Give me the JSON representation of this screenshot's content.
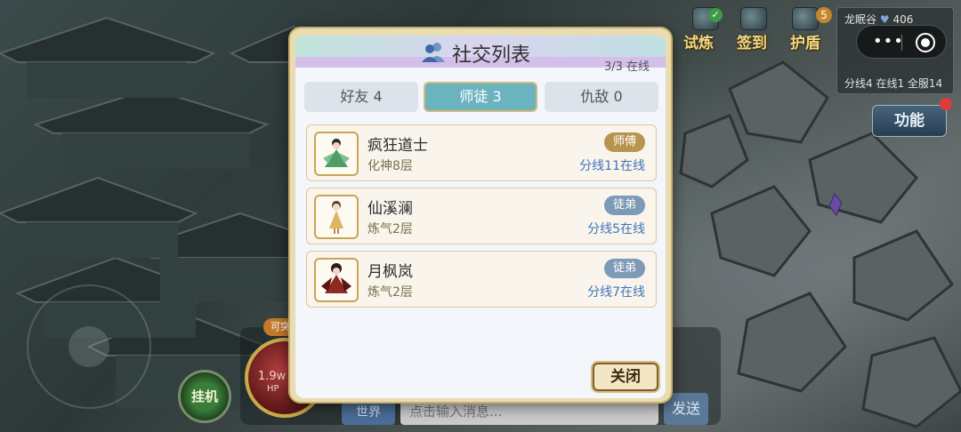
{
  "hud": {
    "trial_label": "试炼",
    "signin_label": "签到",
    "shield_label": "护盾",
    "shield_badge": "5",
    "function_label": "功能",
    "hangup_label": "挂机",
    "hp_value": "1.9w",
    "hp_label": "HP",
    "orb_tag": "可突",
    "send_label": "发送",
    "chat_channel": "世界",
    "chat_placeholder": "点击输入消息..."
  },
  "minimap": {
    "location": "龙眠谷",
    "coord": "406",
    "status": "分线4 在线1 全服14"
  },
  "dialog": {
    "title": "社交列表",
    "online_count": "3/3 在线",
    "tabs": [
      {
        "label": "好友 4",
        "active": false
      },
      {
        "label": "师徒 3",
        "active": true
      },
      {
        "label": "仇敌 0",
        "active": false
      }
    ],
    "entries": [
      {
        "name": "疯狂道士",
        "level": "化神8层",
        "role": "师傅",
        "role_color": "#b8954f",
        "line_status": "分线11在线"
      },
      {
        "name": "仙溪澜",
        "level": "炼气2层",
        "role": "徒弟",
        "role_color": "#7d9ab6",
        "line_status": "分线5在线"
      },
      {
        "name": "月枫岚",
        "level": "炼气2层",
        "role": "徒弟",
        "role_color": "#7d9ab6",
        "line_status": "分线7在线"
      }
    ],
    "close_label": "关闭"
  }
}
